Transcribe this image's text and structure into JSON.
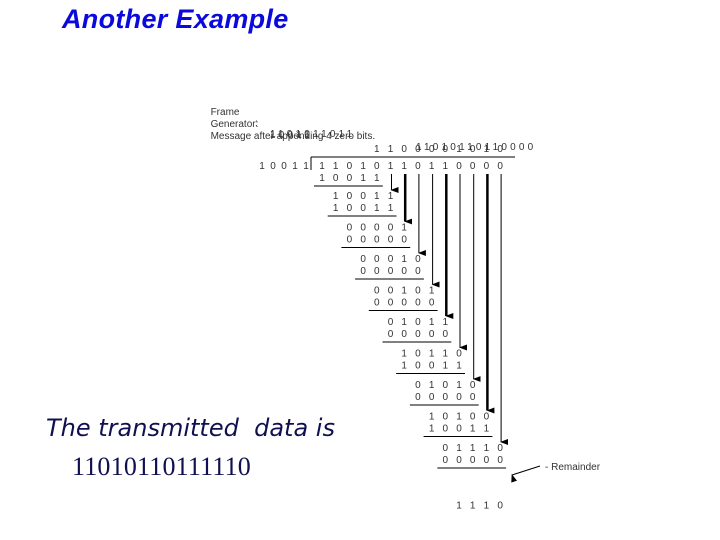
{
  "title": "Another Example",
  "diagram": {
    "frame_label": "Frame",
    "frame_value": "1101011011",
    "generator_label": "Generator:",
    "generator_value": "10011",
    "message_label": "Message after appending 4 zero bits.",
    "message_value": "11010110110000",
    "divisor": "10011",
    "quotient": "1100001010",
    "dividend": "11010110110000",
    "steps": [
      {
        "minuend": "11010",
        "subtrahend": "10011"
      },
      {
        "minuend": "10011",
        "subtrahend": "10011"
      },
      {
        "minuend": "00001",
        "subtrahend": "00000"
      },
      {
        "minuend": "00010",
        "subtrahend": "00000"
      },
      {
        "minuend": "00101",
        "subtrahend": "00000"
      },
      {
        "minuend": "01011",
        "subtrahend": "00000"
      },
      {
        "minuend": "10110",
        "subtrahend": "10011"
      },
      {
        "minuend": "01010",
        "subtrahend": "00000"
      },
      {
        "minuend": "10100",
        "subtrahend": "10011"
      },
      {
        "minuend": "01110",
        "subtrahend": "00000"
      }
    ],
    "remainder": "1110",
    "remainder_label": "Remainder"
  },
  "caption": "The transmitted  data is",
  "transmitted": "11010110111110"
}
